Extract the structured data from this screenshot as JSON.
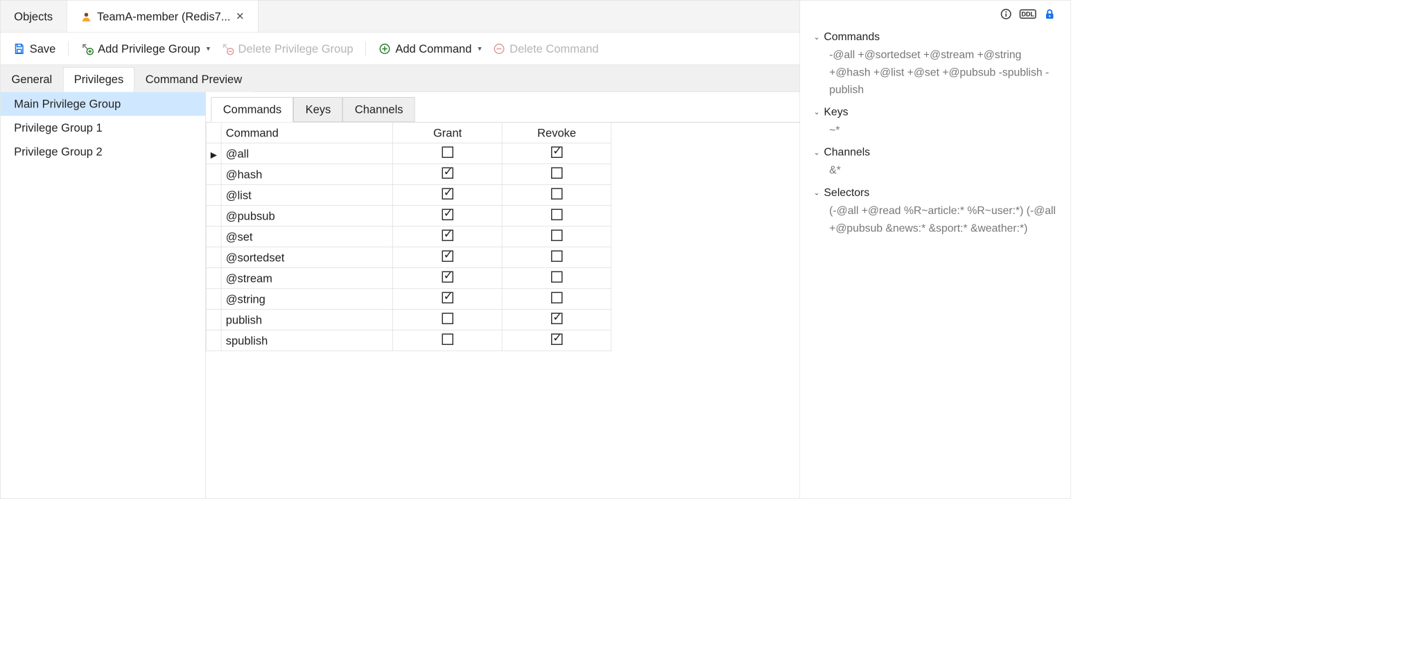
{
  "doc_tabs": {
    "objects": "Objects",
    "editor": "TeamA-member (Redis7..."
  },
  "toolbar": {
    "save": "Save",
    "add_priv_group": "Add Privilege Group",
    "del_priv_group": "Delete Privilege Group",
    "add_command": "Add Command",
    "del_command": "Delete Command"
  },
  "section_tabs": {
    "general": "General",
    "privileges": "Privileges",
    "preview": "Command Preview"
  },
  "privilege_groups": [
    {
      "label": "Main Privilege Group",
      "selected": true
    },
    {
      "label": "Privilege Group 1",
      "selected": false
    },
    {
      "label": "Privilege Group 2",
      "selected": false
    }
  ],
  "inner_tabs": {
    "commands": "Commands",
    "keys": "Keys",
    "channels": "Channels"
  },
  "grid": {
    "headers": {
      "command": "Command",
      "grant": "Grant",
      "revoke": "Revoke"
    },
    "rows": [
      {
        "cmd": "@all",
        "grant": false,
        "revoke": true,
        "current": true
      },
      {
        "cmd": "@hash",
        "grant": true,
        "revoke": false,
        "current": false
      },
      {
        "cmd": "@list",
        "grant": true,
        "revoke": false,
        "current": false
      },
      {
        "cmd": "@pubsub",
        "grant": true,
        "revoke": false,
        "current": false
      },
      {
        "cmd": "@set",
        "grant": true,
        "revoke": false,
        "current": false
      },
      {
        "cmd": "@sortedset",
        "grant": true,
        "revoke": false,
        "current": false
      },
      {
        "cmd": "@stream",
        "grant": true,
        "revoke": false,
        "current": false
      },
      {
        "cmd": "@string",
        "grant": true,
        "revoke": false,
        "current": false
      },
      {
        "cmd": "publish",
        "grant": false,
        "revoke": true,
        "current": false
      },
      {
        "cmd": "spublish",
        "grant": false,
        "revoke": true,
        "current": false
      }
    ]
  },
  "side": {
    "commands_label": "Commands",
    "commands_value": "-@all +@sortedset +@stream +@string +@hash +@list +@set +@pubsub -spublish - publish",
    "keys_label": "Keys",
    "keys_value": "~*",
    "channels_label": "Channels",
    "channels_value": "&*",
    "selectors_label": "Selectors",
    "selectors_value": "(-@all +@read %R~article:* %R~user:*) (-@all +@pubsub &news:* &sport:* &weather:*)"
  }
}
